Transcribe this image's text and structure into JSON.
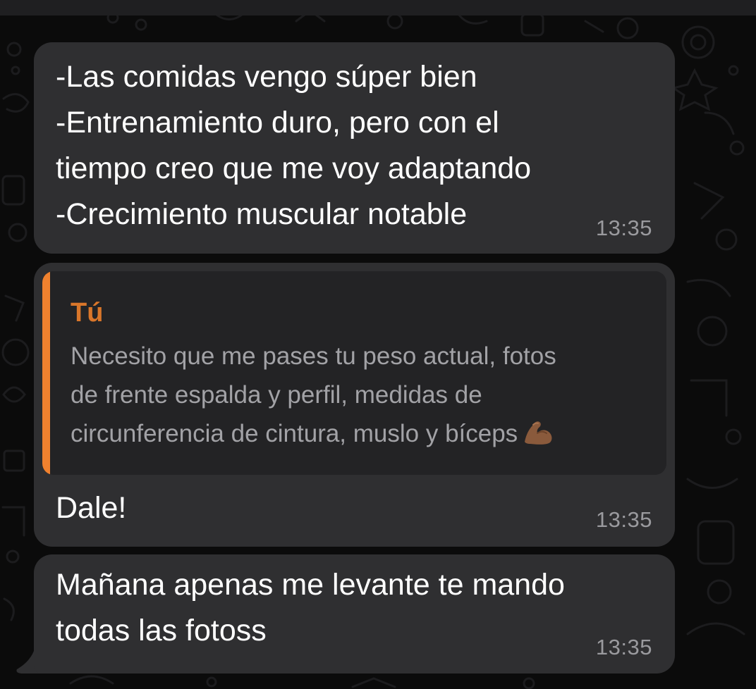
{
  "messages": [
    {
      "text": "-Las comidas vengo súper bien\n-Entrenamiento duro, pero con el\ntiempo creo que me voy adaptando\n-Crecimiento muscular notable",
      "time": "13:35"
    },
    {
      "quote": {
        "author": "Tú",
        "text": "Necesito que me pases tu peso actual, fotos\nde frente espalda y perfil, medidas de\ncircunferencia de cintura, muslo y bíceps",
        "emoji": "flexed-biceps-emoji"
      },
      "text": "Dale!",
      "time": "13:35"
    },
    {
      "text": "Mañana apenas me levante te mando\ntodas las fotoss",
      "time": "13:35"
    }
  ],
  "colors": {
    "bubble": "#2f2f31",
    "quote_bar": "#f0812e",
    "quote_author": "#d9762a",
    "timestamp": "#9a9a9e"
  }
}
